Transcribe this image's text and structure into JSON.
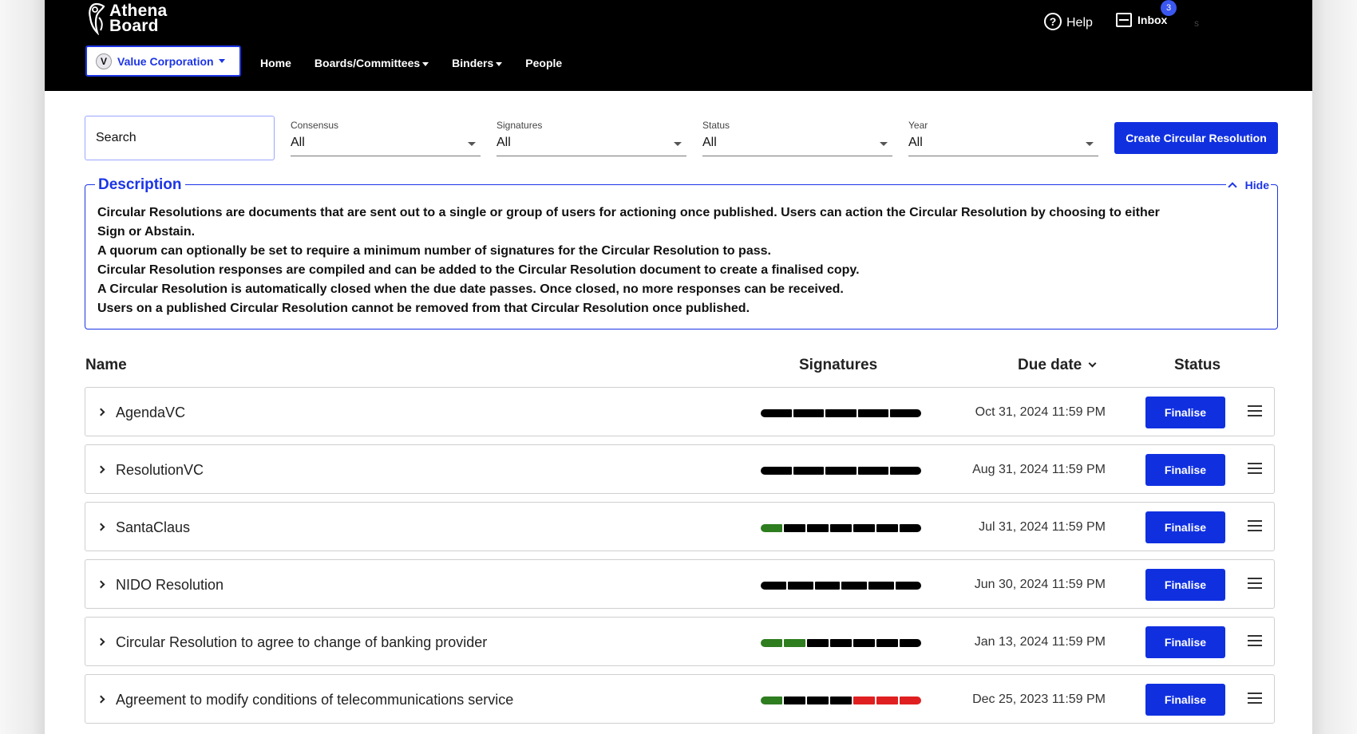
{
  "colors": {
    "accent": "#1030e0",
    "signed": "#2e7d1f",
    "pending": "#000000",
    "abstained": "#e02020",
    "header_bg": "#000000"
  },
  "header": {
    "logo_line1": "Athena",
    "logo_line2": "Board",
    "org_badge": "V",
    "org_name": "Value Corporation",
    "nav": [
      "Home",
      "Boards/Committees",
      "Binders",
      "People"
    ],
    "help_label": "Help",
    "inbox_label": "Inbox",
    "inbox_count": "3",
    "user_initial": "s"
  },
  "filters": {
    "search_placeholder": "Search",
    "consensus": {
      "label": "Consensus",
      "value": "All"
    },
    "signatures": {
      "label": "Signatures",
      "value": "All"
    },
    "status": {
      "label": "Status",
      "value": "All"
    },
    "year": {
      "label": "Year",
      "value": "All"
    },
    "create_label": "Create Circular Resolution"
  },
  "description": {
    "title": "Description",
    "hide_label": "Hide",
    "lines": [
      "Circular Resolutions are documents that are sent out to a single or group of users for actioning once published. Users can action the Circular Resolution by choosing to either",
      "Sign or Abstain.",
      "A quorum can optionally be set to require a minimum number of signatures for the Circular Resolution to pass.",
      "Circular Resolution responses are compiled and can be added to the Circular Resolution document to create a finalised copy.",
      "A Circular Resolution is automatically closed when the due date passes. Once closed, no more responses can be received.",
      "Users on a published Circular Resolution cannot be removed from that Circular Resolution once published."
    ]
  },
  "table": {
    "headers": {
      "name": "Name",
      "signatures": "Signatures",
      "due_date": "Due date",
      "status": "Status"
    },
    "rows": [
      {
        "name": "AgendaVC",
        "due": "Oct 31, 2024 11:59 PM",
        "action": "Finalise",
        "segments": [
          "pending",
          "pending",
          "pending",
          "pending",
          "pending"
        ]
      },
      {
        "name": "ResolutionVC",
        "due": "Aug 31, 2024 11:59 PM",
        "action": "Finalise",
        "segments": [
          "pending",
          "pending",
          "pending",
          "pending",
          "pending"
        ]
      },
      {
        "name": "SantaClaus",
        "due": "Jul 31, 2024 11:59 PM",
        "action": "Finalise",
        "segments": [
          "signed",
          "pending",
          "pending",
          "pending",
          "pending",
          "pending",
          "pending"
        ]
      },
      {
        "name": "NIDO Resolution",
        "due": "Jun 30, 2024 11:59 PM",
        "action": "Finalise",
        "segments": [
          "pending",
          "pending",
          "pending",
          "pending",
          "pending",
          "pending"
        ]
      },
      {
        "name": "Circular Resolution to agree to change of banking provider",
        "due": "Jan 13, 2024 11:59 PM",
        "action": "Finalise",
        "segments": [
          "signed",
          "signed",
          "pending",
          "pending",
          "pending",
          "pending",
          "pending"
        ]
      },
      {
        "name": "Agreement to modify conditions of telecommunications service",
        "due": "Dec 25, 2023 11:59 PM",
        "action": "Finalise",
        "segments": [
          "signed",
          "pending",
          "pending",
          "pending",
          "abstained",
          "abstained",
          "abstained"
        ]
      }
    ]
  }
}
